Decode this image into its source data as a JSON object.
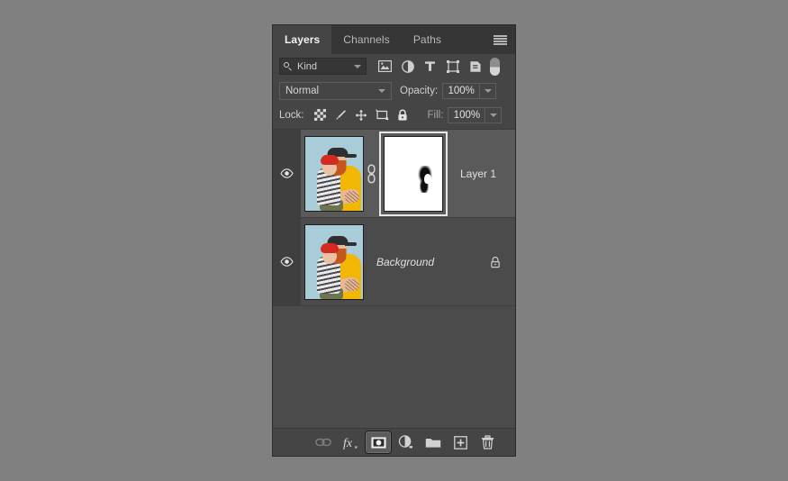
{
  "app": {
    "panel_title": "Layers",
    "background_color": "#808080",
    "panel_bg": "#4b4b4b",
    "selected_row_bg": "#5a5a5a"
  },
  "tabs": [
    {
      "label": "Layers",
      "active": true
    },
    {
      "label": "Channels",
      "active": false
    },
    {
      "label": "Paths",
      "active": false
    }
  ],
  "panel_menu": {
    "icon": "hamburger-menu-icon"
  },
  "filter_row": {
    "search_icon": "search-icon",
    "kind_label": "Kind",
    "dropdown_icon": "chevron-down-icon",
    "filter_icons": [
      {
        "name": "pixel-layer-filter-icon"
      },
      {
        "name": "adjustment-layer-filter-icon"
      },
      {
        "name": "type-layer-filter-icon",
        "glyph": "T"
      },
      {
        "name": "shape-layer-filter-icon"
      },
      {
        "name": "smart-object-filter-icon"
      }
    ],
    "toggle": {
      "name": "filter-enable-toggle",
      "state": "off"
    }
  },
  "blend_row": {
    "blend_mode": "Normal",
    "blend_dropdown_icon": "chevron-down-icon",
    "opacity_label": "Opacity:",
    "opacity_value": "100%",
    "opacity_dropdown_icon": "chevron-down-icon"
  },
  "lock_row": {
    "lock_label": "Lock:",
    "lock_icons": [
      {
        "name": "lock-transparent-pixels-icon"
      },
      {
        "name": "lock-image-pixels-icon"
      },
      {
        "name": "lock-position-icon"
      },
      {
        "name": "lock-artboard-nesting-icon"
      },
      {
        "name": "lock-all-icon"
      }
    ],
    "fill_label": "Fill:",
    "fill_value": "100%",
    "fill_dropdown_icon": "chevron-down-icon"
  },
  "layers": [
    {
      "name": "Layer 1",
      "visible": true,
      "selected": true,
      "italic": false,
      "locked": false,
      "has_mask": true,
      "mask_selected": true,
      "linked": true,
      "thumbnail": "photo-man-and-girl",
      "mask_thumbnail": "white-mask-with-black-brush-stroke"
    },
    {
      "name": "Background",
      "visible": true,
      "selected": false,
      "italic": true,
      "locked": true,
      "has_mask": false,
      "mask_selected": false,
      "linked": false,
      "thumbnail": "photo-man-and-girl",
      "mask_thumbnail": ""
    }
  ],
  "bottom_bar": {
    "buttons": [
      {
        "name": "link-layers-button",
        "label": "",
        "state": "disabled"
      },
      {
        "name": "layer-style-fx-button",
        "label": "fx",
        "state": "normal"
      },
      {
        "name": "add-layer-mask-button",
        "label": "",
        "state": "active"
      },
      {
        "name": "new-adjustment-layer-button",
        "label": "",
        "state": "normal"
      },
      {
        "name": "new-group-button",
        "label": "",
        "state": "normal"
      },
      {
        "name": "new-layer-button",
        "label": "",
        "state": "normal"
      },
      {
        "name": "delete-layer-button",
        "label": "",
        "state": "normal"
      }
    ]
  }
}
